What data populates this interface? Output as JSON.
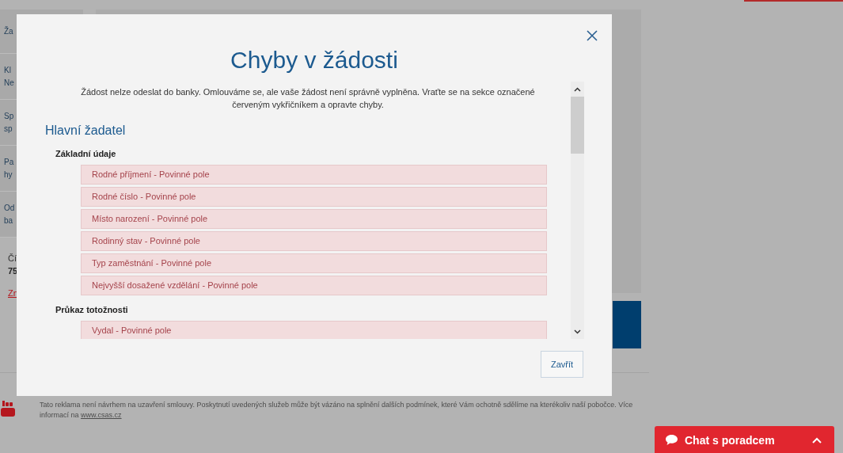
{
  "background": {
    "sidebar_items": [
      {
        "lines": [
          "Ža"
        ]
      },
      {
        "lines": [
          "Kl",
          "Ne"
        ]
      },
      {
        "lines": [
          "Sp",
          "sp"
        ]
      },
      {
        "lines": [
          "Pa",
          "hy"
        ]
      },
      {
        "lines": [
          "Od",
          "ba"
        ]
      }
    ],
    "number_label": "Čí",
    "number_value": "75",
    "link": "Zn",
    "footer": {
      "text": "Tato reklama není návrhem na uzavření smlouvy. Poskytnutí uvedených služeb může být vázáno na splnění dalších podmínek, které Vám ochotně sdělíme na kterékoliv naší pobočce. Více informací na",
      "link": "www.csas.cz"
    },
    "chat_button": {
      "label": "Chat s poradcem"
    }
  },
  "dialog": {
    "title": "Chyby v žádosti",
    "message": "Žádost nelze odeslat do banky. Omlouváme se, ale vaše žádost není správně vyplněna. Vraťte se na sekce označené červeným vykřičníkem a opravte chyby.",
    "sections": [
      {
        "heading": "Hlavní žadatel",
        "groups": [
          {
            "title": "Základní údaje",
            "errors": [
              "Rodné příjmení - Povinné pole",
              "Rodné číslo - Povinné pole",
              "Místo narození - Povinné pole",
              "Rodinný stav - Povinné pole",
              "Typ zaměstnání - Povinné pole",
              "Nejvyšší dosažené vzdělání - Povinné pole"
            ]
          },
          {
            "title": "Průkaz totožnosti",
            "errors": [
              "Vydal - Povinné pole"
            ]
          }
        ]
      }
    ],
    "close_button": "Zavřít"
  }
}
